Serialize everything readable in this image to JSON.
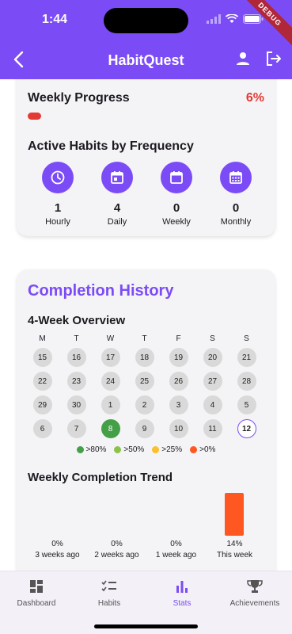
{
  "status": {
    "time": "1:44",
    "debug_label": "DEBUG"
  },
  "appbar": {
    "title": "HabitQuest"
  },
  "weekly_progress": {
    "title": "Weekly Progress",
    "percent_text": "6%",
    "progress": 0.06
  },
  "frequency": {
    "title": "Active Habits by Frequency",
    "items": [
      {
        "icon": "clock-icon",
        "count": "1",
        "label": "Hourly"
      },
      {
        "icon": "calendar-day-icon",
        "count": "4",
        "label": "Daily"
      },
      {
        "icon": "calendar-week-icon",
        "count": "0",
        "label": "Weekly"
      },
      {
        "icon": "calendar-month-icon",
        "count": "0",
        "label": "Monthly"
      }
    ]
  },
  "history": {
    "title": "Completion History",
    "overview_title": "4-Week Overview",
    "weekdays": [
      "M",
      "T",
      "W",
      "T",
      "F",
      "S",
      "S"
    ],
    "weeks": [
      [
        "15",
        "16",
        "17",
        "18",
        "19",
        "20",
        "21"
      ],
      [
        "22",
        "23",
        "24",
        "25",
        "26",
        "27",
        "28"
      ],
      [
        "29",
        "30",
        "1",
        "2",
        "3",
        "4",
        "5"
      ],
      [
        "6",
        "7",
        "8",
        "9",
        "10",
        "11",
        "12"
      ]
    ],
    "legend": [
      {
        "label": ">80%",
        "color": "#43a047"
      },
      {
        "label": ">50%",
        "color": "#8bc34a"
      },
      {
        "label": ">25%",
        "color": "#fbc02d"
      },
      {
        "label": ">0%",
        "color": "#ff5722"
      }
    ],
    "trend_title": "Weekly Completion Trend",
    "trend": [
      {
        "pct": "0%",
        "label": "3 weeks ago",
        "value": 0
      },
      {
        "pct": "0%",
        "label": "2 weeks ago",
        "value": 0
      },
      {
        "pct": "0%",
        "label": "1 week ago",
        "value": 0
      },
      {
        "pct": "14%",
        "label": "This week",
        "value": 14
      }
    ]
  },
  "nav": {
    "items": [
      {
        "label": "Dashboard",
        "icon": "dashboard-icon"
      },
      {
        "label": "Habits",
        "icon": "checklist-icon"
      },
      {
        "label": "Stats",
        "icon": "bar-chart-icon"
      },
      {
        "label": "Achievements",
        "icon": "trophy-icon"
      }
    ],
    "active_index": 2
  },
  "colors": {
    "primary": "#7b4cf6",
    "danger": "#e53935",
    "trend_bar": "#ff5722"
  }
}
